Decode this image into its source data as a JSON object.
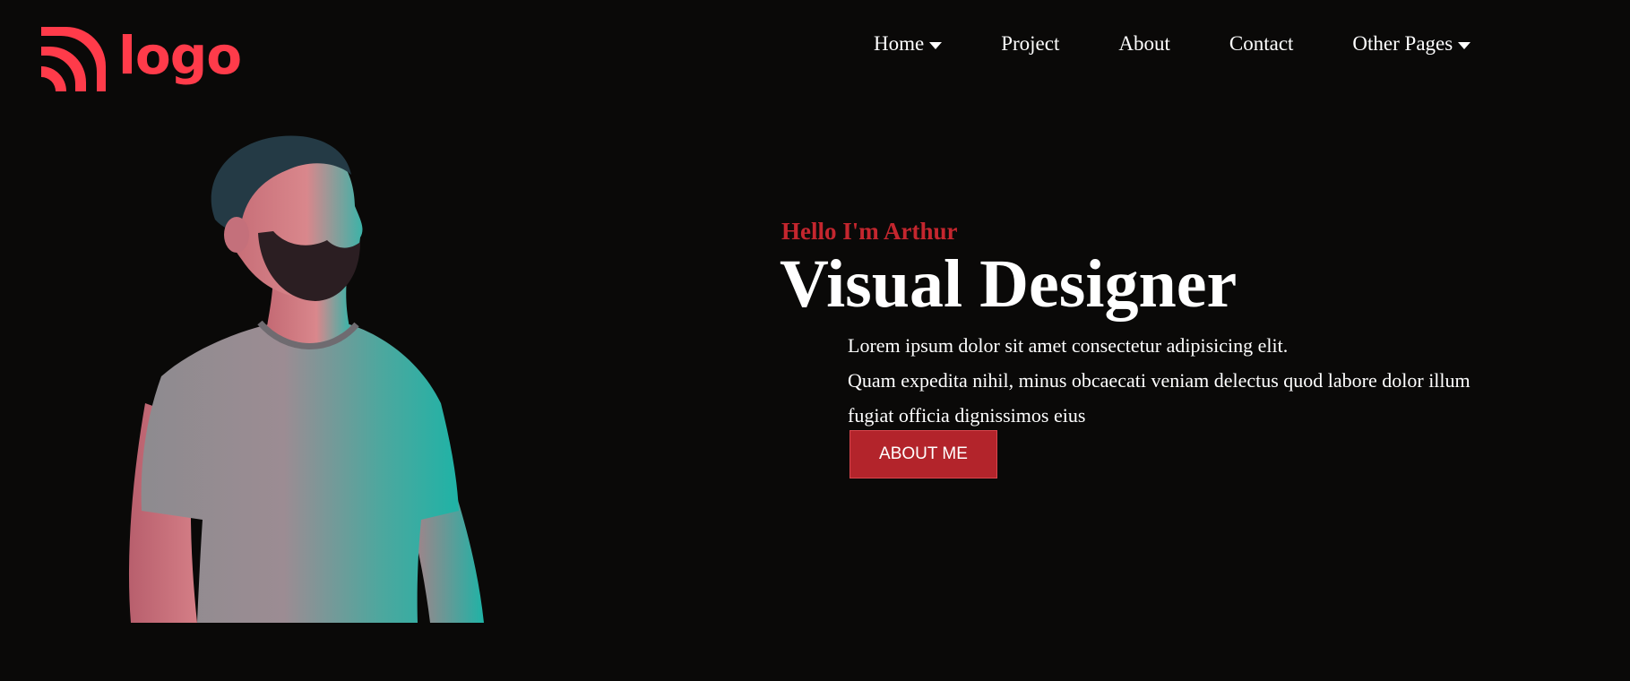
{
  "logo": {
    "text": "logo",
    "icon": "wifi-signal-logo-icon",
    "color": "#ff3b4a"
  },
  "nav": {
    "items": [
      {
        "label": "Home",
        "has_dropdown": true
      },
      {
        "label": "Project",
        "has_dropdown": false
      },
      {
        "label": "About",
        "has_dropdown": false
      },
      {
        "label": "Contact",
        "has_dropdown": false
      },
      {
        "label": "Other Pages",
        "has_dropdown": true
      }
    ],
    "dropdown_icon": "caret-down-icon"
  },
  "hero": {
    "greeting": "Hello I'm Arthur",
    "headline": "Visual Designer",
    "description_line1": "Lorem ipsum dolor sit amet consectetur adipisicing elit.",
    "description_line2": "Quam expedita nihil, minus obcaecati veniam delectus quod labore dolor illum fugiat officia dignissimos eius",
    "cta_label": "ABOUT ME",
    "portrait": "portrait-photo"
  },
  "colors": {
    "background": "#0a0908",
    "accent": "#c4262e",
    "button": "#b3242b",
    "text": "#ffffff"
  }
}
